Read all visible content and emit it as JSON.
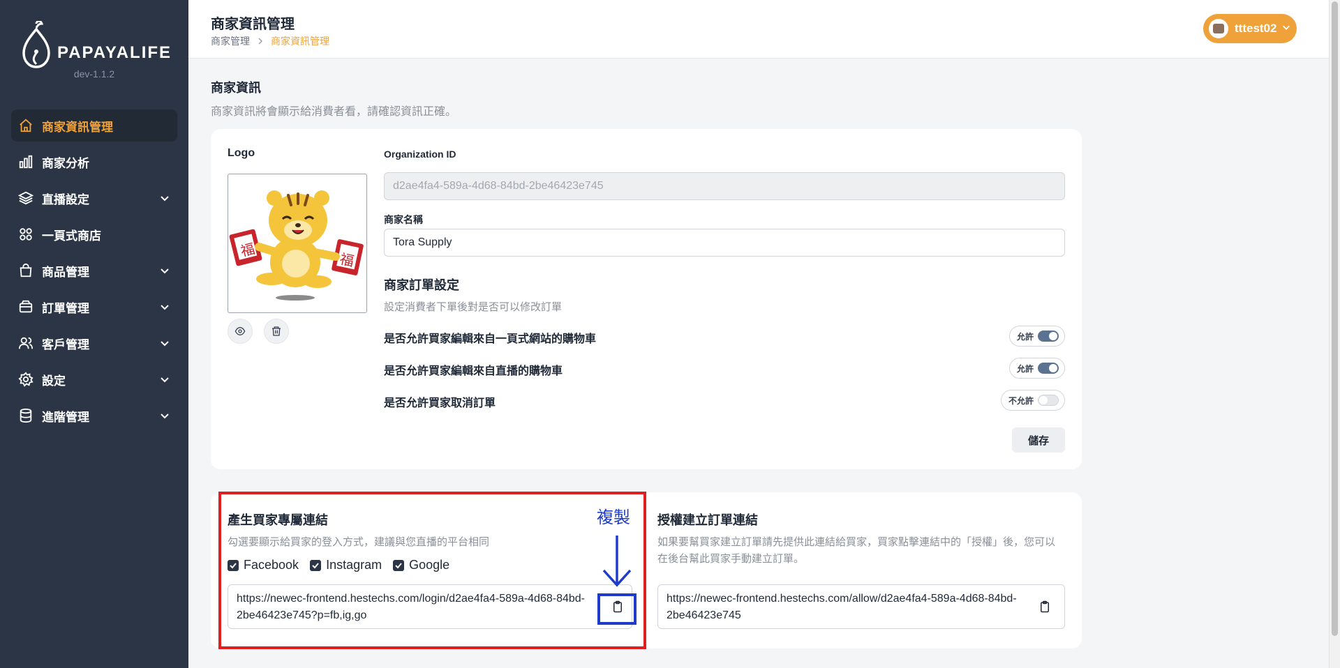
{
  "app": {
    "brand": "PAPAYALIFE",
    "version": "dev-1.1.2"
  },
  "sidebar": {
    "items": [
      {
        "label": "商家資訊管理",
        "icon": "home-icon",
        "active": true,
        "expandable": false
      },
      {
        "label": "商家分析",
        "icon": "bar-chart-icon",
        "active": false,
        "expandable": false
      },
      {
        "label": "直播設定",
        "icon": "layers-icon",
        "active": false,
        "expandable": true
      },
      {
        "label": "一頁式商店",
        "icon": "grid-icon",
        "active": false,
        "expandable": false
      },
      {
        "label": "商品管理",
        "icon": "shopping-bag-icon",
        "active": false,
        "expandable": true
      },
      {
        "label": "訂單管理",
        "icon": "inbox-icon",
        "active": false,
        "expandable": true
      },
      {
        "label": "客戶管理",
        "icon": "users-icon",
        "active": false,
        "expandable": true
      },
      {
        "label": "設定",
        "icon": "gear-icon",
        "active": false,
        "expandable": true
      },
      {
        "label": "進階管理",
        "icon": "database-icon",
        "active": false,
        "expandable": true
      }
    ]
  },
  "header": {
    "title": "商家資訊管理",
    "breadcrumb": [
      "商家管理",
      "商家資訊管理"
    ],
    "user": "tttest02"
  },
  "merchant": {
    "section_title": "商家資訊",
    "section_desc": "商家資訊將會顯示給消費者看，請確認資訊正確。",
    "logo_label": "Logo",
    "org_id_label": "Organization ID",
    "org_id_value": "d2ae4fa4-589a-4d68-84bd-2be46423e745",
    "name_label": "商家名稱",
    "name_value": "Tora Supply",
    "order_settings_title": "商家訂單設定",
    "order_settings_desc": "設定消費者下單後對是否可以修改訂單",
    "settings": [
      {
        "label": "是否允許買家編輯來自一頁式網站的購物車",
        "state_label": "允許",
        "on": true
      },
      {
        "label": "是否允許買家編輯來自直播的購物車",
        "state_label": "允許",
        "on": true
      },
      {
        "label": "是否允許買家取消訂單",
        "state_label": "不允許",
        "on": false
      }
    ],
    "save_label": "儲存"
  },
  "buyer_link": {
    "title": "產生買家專屬連結",
    "desc": "勾選要顯示給買家的登入方式，建議與您直播的平台相同",
    "options": [
      "Facebook",
      "Instagram",
      "Google"
    ],
    "url": "https://newec-frontend.hestechs.com/login/d2ae4fa4-589a-4d68-84bd-2be46423e745?p=fb,ig,go"
  },
  "auth_link": {
    "title": "授權建立訂單連結",
    "desc": "如果要幫買家建立訂單請先提供此連結給買家，買家點擊連結中的「授權」後，您可以在後台幫此買家手動建立訂單。",
    "url": "https://newec-frontend.hestechs.com/allow/d2ae4fa4-589a-4d68-84bd-2be46423e745"
  },
  "annotation": {
    "copy_label": "複製"
  },
  "colors": {
    "accent": "#f0a23a",
    "sidebar": "#2b3545",
    "annotation_red": "#e02020",
    "annotation_blue": "#1e3cc8"
  }
}
